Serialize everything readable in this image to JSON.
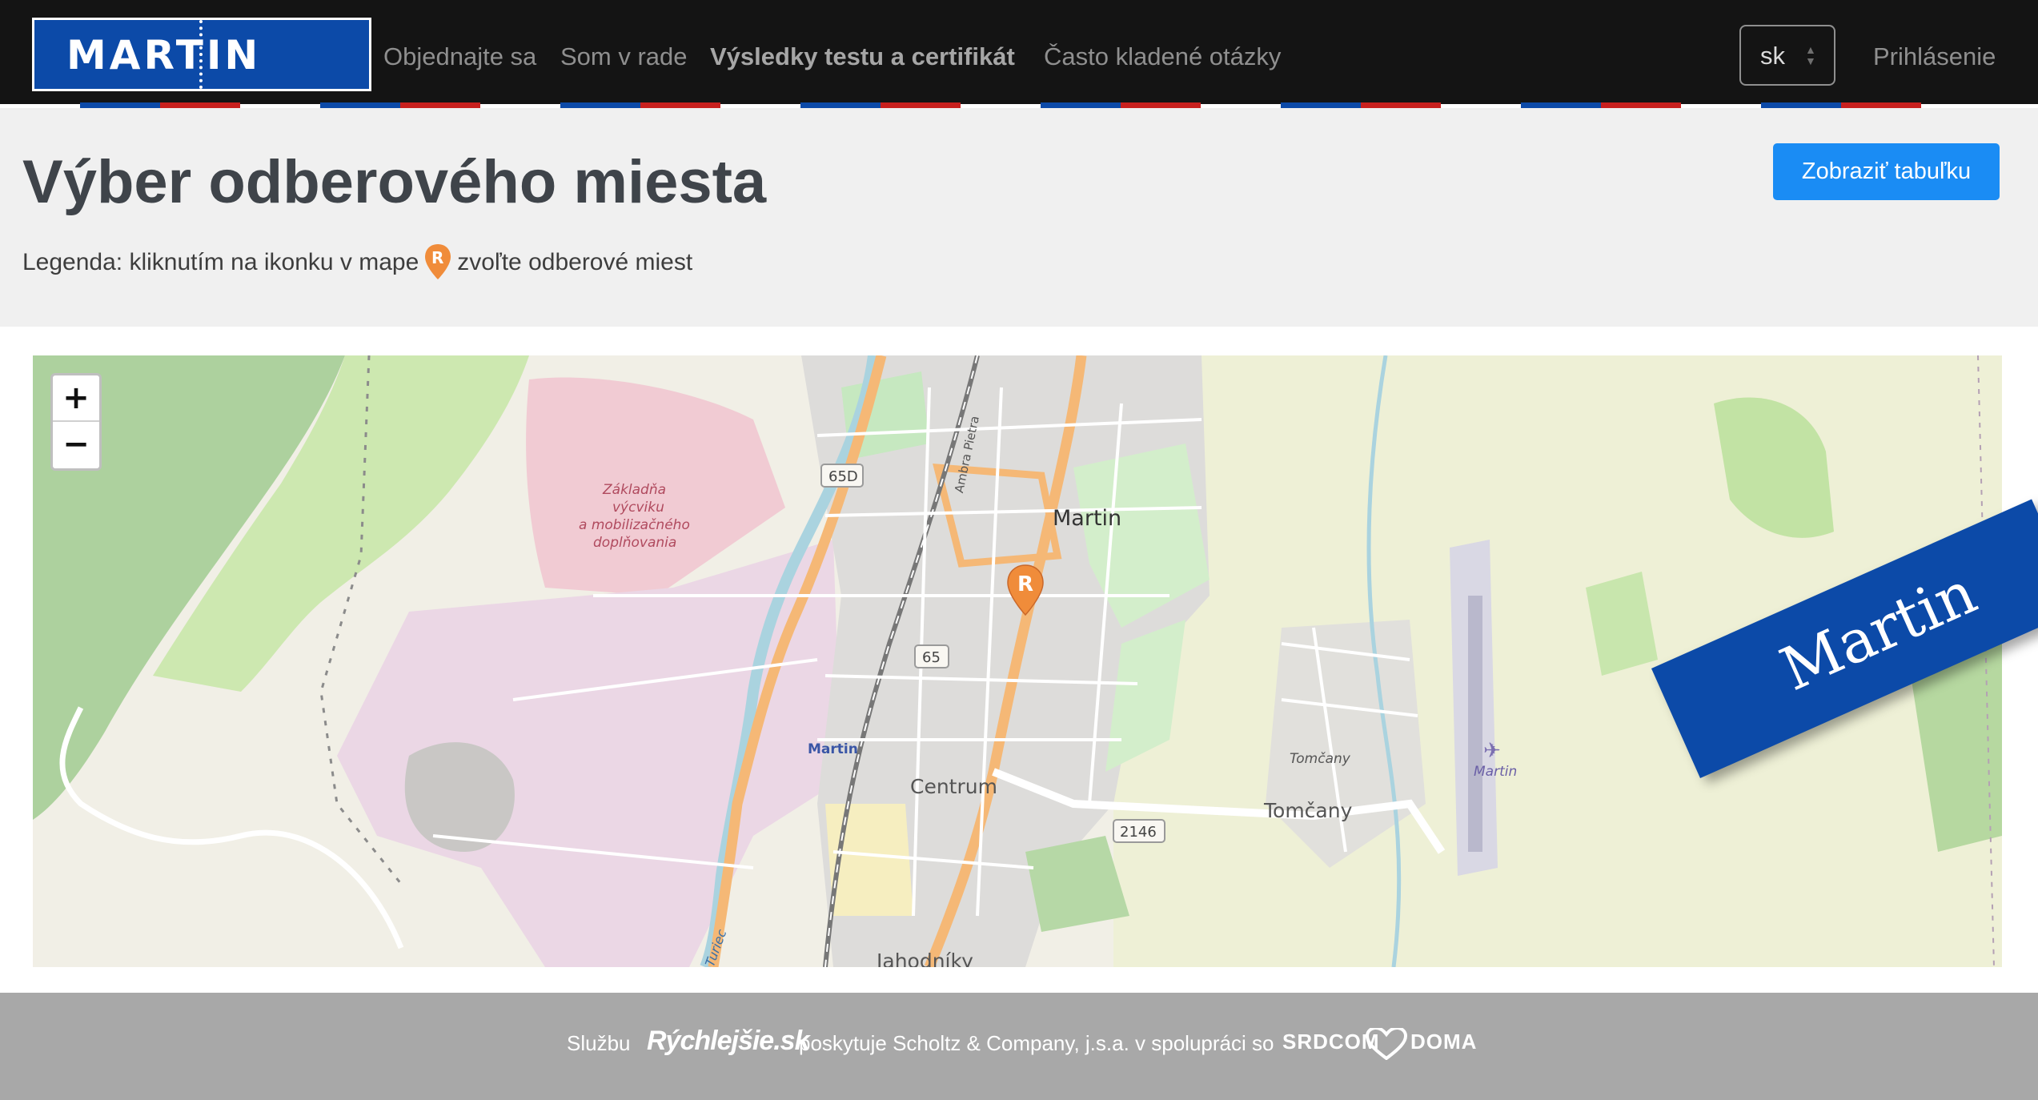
{
  "navbar": {
    "logo_text": "MARTIN",
    "links": [
      {
        "label": "Objednajte sa"
      },
      {
        "label": "Som v rade"
      },
      {
        "label": "Výsledky testu a certifikát",
        "active": true
      },
      {
        "label": "Často kladené otázky"
      }
    ],
    "language": {
      "selected": "sk"
    },
    "login_label": "Prihlásenie"
  },
  "header": {
    "title": "Výber odberového miesta",
    "legend_before": "Legenda: kliknutím na ikonku v mape",
    "legend_after": "zvoľte odberové miest",
    "table_button_label": "Zobraziť tabuľku"
  },
  "map": {
    "zoom_in": "+",
    "zoom_out": "−",
    "labels": {
      "base_line1": "Základňa",
      "base_line2": "výcviku",
      "base_line3": "a mobilizačného",
      "base_line4": "doplňovania",
      "city": "Martin",
      "street": "Ambra Pietra",
      "station": "Martin",
      "centrum": "Centrum",
      "tomcany_small": "Tomčany",
      "tomcany": "Tomčany",
      "airport": "Martin",
      "jahodniky": "Jahodníky",
      "river": "Turiec"
    },
    "road_shields": [
      "65D",
      "65",
      "2146"
    ],
    "ribbon_text": "Martin",
    "pin_icon": "location-pin-R-icon",
    "pin_letter": "R"
  },
  "footer": {
    "service_label": "Službu",
    "brand": "Rýchlejšie.sk",
    "provided_by": "poskytuje Scholtz & Company, j.s.a. v spolupráci so",
    "partner_left": "SRDCOM",
    "partner_right": "DOMA"
  },
  "colors": {
    "navbar_bg": "#141414",
    "brand_blue": "#0c4aa8",
    "brand_red": "#c8201e",
    "button_blue": "#1a8cf4",
    "pin_orange": "#f08c3a",
    "footer_bg": "#a8a8a8"
  }
}
